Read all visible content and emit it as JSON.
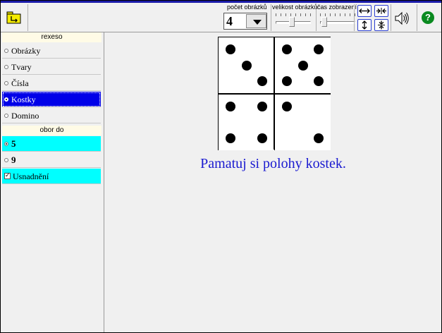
{
  "toolbar": {
    "count_label": "počet obrázků",
    "count_value": "4",
    "size_label": "velikost obrázků",
    "time_label": "čas zobrazení",
    "size_level": 0.45,
    "time_level": 0.05,
    "icons": [
      "open-folder-icon",
      "expand-horizontal-icon",
      "shrink-horizontal-icon",
      "expand-vertical-icon",
      "shrink-vertical-icon",
      "speaker-icon",
      "help-icon"
    ]
  },
  "sidebar": {
    "game_header": "rexeso",
    "game_options": [
      {
        "label": "Obrázky",
        "selected": false
      },
      {
        "label": "Tvary",
        "selected": false
      },
      {
        "label": "Čísla",
        "selected": false
      },
      {
        "label": "Kostky",
        "selected": true
      },
      {
        "label": "Domino",
        "selected": false
      }
    ],
    "range_header": "obor do",
    "range_options": [
      {
        "label": "5",
        "selected": true
      },
      {
        "label": "9",
        "selected": false
      }
    ],
    "hint_label": "Usnadnění",
    "hint_checked": true
  },
  "board": {
    "cards": [
      {
        "pips": 3
      },
      {
        "pips": 5
      },
      {
        "pips": 4
      },
      {
        "pips": 2
      }
    ]
  },
  "message": "Pamatuj si polohy kostek.",
  "colors": {
    "selected_blue": "#0000e8",
    "highlight_cyan": "#00ffff",
    "message_blue": "#1a1ad0",
    "title_bar": "#1a1aa8"
  }
}
